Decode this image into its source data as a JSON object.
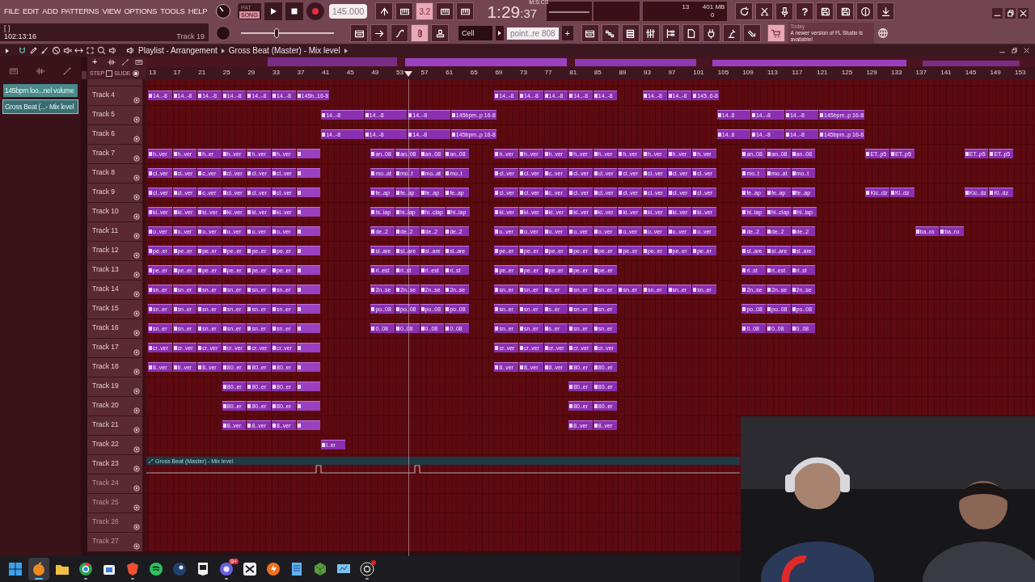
{
  "menu": [
    "FILE",
    "EDIT",
    "ADD",
    "PATTERNS",
    "VIEW",
    "OPTIONS",
    "TOOLS",
    "HELP"
  ],
  "hint": {
    "text": "[ ]",
    "time": "102:13:16",
    "track": "Track 19"
  },
  "mode": [
    {
      "label": "PAT",
      "selected": false
    },
    {
      "label": "SONG",
      "selected": true
    }
  ],
  "tempo": "145.000",
  "time": {
    "label": "M:S:CS",
    "value": "1:29",
    "centiseconds": ":37"
  },
  "monitor": {
    "voices": "13",
    "memory": "401 MB",
    "cpu": "0"
  },
  "transport_buttons": [
    {
      "selected": false
    },
    {
      "selected": false
    },
    {
      "selected": true,
      "text": "3.2"
    },
    {
      "selected": false
    },
    {
      "selected": false
    }
  ],
  "help": "?",
  "pitch": {
    "level": 0.38
  },
  "tool_buttons": [
    {
      "selected": false
    },
    {
      "selected": false
    },
    {
      "selected": false
    },
    {
      "selected": true
    },
    {
      "selected": false
    }
  ],
  "snap": "Cell",
  "pattern": "point..re 808",
  "add": "+",
  "news": {
    "date": "Today",
    "text": "A newer version of FL Studio is available!"
  },
  "playlist": {
    "breadcrumb": [
      "Playlist - Arrangement",
      "Gross Beat (Master) - Mix level"
    ],
    "browser": [
      {
        "label": "145bpm loo...nel volume",
        "selected": false
      },
      {
        "label": "Gross Beat (...- Mix level",
        "selected": true
      }
    ],
    "add": "+",
    "step": {
      "label": "STEP",
      "checked": false
    },
    "slide": {
      "label": "SLIDE",
      "on": true
    },
    "ruler": [
      "13",
      "17",
      "21",
      "25",
      "29",
      "33",
      "37",
      "41",
      "45",
      "49",
      "53",
      "57",
      "61",
      "65",
      "69",
      "73",
      "77",
      "81",
      "85",
      "89",
      "93",
      "97",
      "101",
      "105",
      "109",
      "113",
      "117",
      "121",
      "125",
      "129",
      "133",
      "137",
      "141",
      "145",
      "149",
      "153"
    ],
    "playhead": {
      "level": 0.295
    },
    "tracks": [
      {
        "name": "Track 4",
        "empty": false,
        "kind": "clips",
        "runs": [
          [
            "14..-8",
            "14..-8",
            "14..-8",
            "14..-8",
            "14..-8",
            "14..-8",
            "145b..16-8"
          ],
          [
            "14..-8",
            "14..-8",
            "14..-8",
            "14..-8",
            "14..-8"
          ],
          [
            "14..-8",
            "14..-8",
            "145..6-8"
          ]
        ]
      },
      {
        "name": "Track 5",
        "empty": false,
        "kind": "clips",
        "runs": [
          [
            "14..-8",
            "14..-8",
            "14..-8",
            "145bpm..p 16-8"
          ],
          [
            "14..8",
            "14..-8",
            "14..-8",
            "145bpm..p 16-8"
          ]
        ]
      },
      {
        "name": "Track 6",
        "empty": false,
        "kind": "clips",
        "runs": [
          [
            "14..-8",
            "14..-8",
            "14..-8",
            "145bpm..p 16-8"
          ],
          [
            "14..8",
            "14..-8",
            "14..-8",
            "145bpm..p 16-8"
          ]
        ]
      },
      {
        "name": "Track 7",
        "empty": false,
        "kind": "clips",
        "runs": [
          [
            "h..ver",
            "h..ver",
            "h..er",
            "h..ver",
            "h..ver",
            "h..ver"
          ],
          [
            "an..08",
            "an..08",
            "an..08",
            "an..08"
          ],
          [
            "h..ver",
            "h..ver",
            "h..ver",
            "h..ver",
            "h..ver",
            "h..ver",
            "h..ver",
            "h..ver",
            "h..ver"
          ],
          [
            "an..08",
            "an..08",
            "an..08"
          ],
          [
            "ET..p5",
            "ET..p5"
          ],
          [
            "ET..p5",
            "ET..p5"
          ]
        ]
      },
      {
        "name": "Track 8",
        "empty": false,
        "kind": "clips",
        "runs": [
          [
            "cl..ver",
            "cl..ver",
            "c..ver",
            "cl..ver",
            "cl..ver",
            "cl..ver"
          ],
          [
            "mo..at",
            "mo..t",
            "mo..at",
            "mo..t"
          ],
          [
            "cl..ver",
            "cl..ver",
            "c..ver",
            "cl..ver",
            "cl..ver",
            "cl..ver",
            "cl..ver",
            "cl..ver",
            "cl..ver"
          ],
          [
            "mo..t",
            "mo..at",
            "mo..t"
          ]
        ]
      },
      {
        "name": "Track 9",
        "empty": false,
        "kind": "clips",
        "runs": [
          [
            "cl..ver",
            "cl..ver",
            "c..ver",
            "cl..ver",
            "cl..ver",
            "cl..ver"
          ],
          [
            "fe..ap",
            "fe..ap",
            "fe..ap",
            "fe..ap"
          ],
          [
            "cl..ver",
            "cl..ver",
            "c..ver",
            "cl..ver",
            "cl..ver",
            "cl..ver",
            "cl..ver",
            "cl..ver",
            "cl..ver"
          ],
          [
            "fe..ap",
            "fe..ap",
            "fe..ap"
          ],
          [
            "Kic..dz",
            "Kl..dz"
          ],
          [
            "Kic..dz",
            "Kl..dz"
          ]
        ]
      },
      {
        "name": "Track 10",
        "empty": false,
        "kind": "clips",
        "runs": [
          [
            "ki..ver",
            "ki..ver",
            "ki..ver",
            "ki..ver",
            "ki..ver",
            "ki..ver"
          ],
          [
            "hi..lap",
            "hi..lap",
            "hi..clap",
            "hi..lap"
          ],
          [
            "ki..ver",
            "ki..ver",
            "ki..ver",
            "ki..ver",
            "ki..ver",
            "ki..ver",
            "ki..ver",
            "ki..ver",
            "ki..ver"
          ],
          [
            "hi..lap",
            "hi..clap",
            "hi..lap"
          ]
        ]
      },
      {
        "name": "Track 11",
        "empty": false,
        "kind": "clips",
        "runs": [
          [
            "o..ver",
            "o..ver",
            "o..ver",
            "o..ver",
            "o..ver",
            "o..ver"
          ],
          [
            "de..2",
            "de..2",
            "de..2",
            "de..2"
          ],
          [
            "o..ver",
            "o..ver",
            "o..ver",
            "o..ver",
            "o..ver",
            "o..ver",
            "o..ver",
            "o..ver",
            "o..ver"
          ],
          [
            "de..2",
            "de..2",
            "de..2"
          ],
          [
            "ba..ro",
            "ba..ro"
          ]
        ]
      },
      {
        "name": "Track 12",
        "empty": false,
        "kind": "clips",
        "runs": [
          [
            "pe..er",
            "pe..er",
            "pe..er",
            "pe..er",
            "pe..er",
            "pe..er"
          ],
          [
            "sl..are",
            "sl..are",
            "sl..are",
            "sl..are"
          ],
          [
            "pe..er",
            "pe..er",
            "pe..er",
            "pe..er",
            "pe..er",
            "pe..er",
            "pe..er",
            "pe..er",
            "pe..er"
          ],
          [
            "sl..are",
            "sl..are",
            "sl..are"
          ]
        ]
      },
      {
        "name": "Track 13",
        "empty": false,
        "kind": "clips",
        "runs": [
          [
            "pe..er",
            "pe..er",
            "pe..er",
            "pe..er",
            "pe..er",
            "pe..er"
          ],
          [
            "rl..est",
            "rl..st",
            "rl..est",
            "rl..st"
          ],
          [
            "pe..er",
            "pe..er",
            "pe..er",
            "pe..er",
            "pe..er"
          ],
          [
            "rl..st",
            "rl..est",
            "rl..st"
          ]
        ]
      },
      {
        "name": "Track 14",
        "empty": false,
        "kind": "clips",
        "runs": [
          [
            "sn..er",
            "sn..er",
            "sn..er",
            "sn..er",
            "sn..er",
            "sn..er"
          ],
          [
            "2n..se",
            "2n..se",
            "2n..se",
            "2n..se"
          ],
          [
            "sn..er",
            "sn..er",
            "s..er",
            "sn..er",
            "sn..er",
            "sn..er",
            "sn..er",
            "sn..er",
            "sn..er"
          ],
          [
            "2n..se",
            "2n..se",
            "2n..se"
          ]
        ]
      },
      {
        "name": "Track 15",
        "empty": false,
        "kind": "clips",
        "runs": [
          [
            "sn..er",
            "sn..er",
            "sn..er",
            "sn..er",
            "sn..er",
            "sn..er"
          ],
          [
            "po..08",
            "po..08",
            "po..08",
            "po..08"
          ],
          [
            "sn..er",
            "sn..er",
            "s..er",
            "sn..er",
            "sn..er"
          ],
          [
            "po..08",
            "po..08",
            "po..08"
          ]
        ]
      },
      {
        "name": "Track 16",
        "empty": false,
        "kind": "clips",
        "runs": [
          [
            "sn..er",
            "sn..er",
            "sn..er",
            "sn..er",
            "sn..er",
            "sn..er"
          ],
          [
            "0..08",
            "0..08",
            "0..08",
            "0..08"
          ],
          [
            "sn..er",
            "sn..er",
            "s..er",
            "sn..er",
            "sn..er"
          ],
          [
            "0..08",
            "0..08",
            "0..08"
          ]
        ]
      },
      {
        "name": "Track 17",
        "empty": false,
        "kind": "clips",
        "runs": [
          [
            "cr..ver",
            "cr..ver",
            "cr..ver",
            "cr..ver",
            "cr..ver",
            "cr..ver"
          ],
          [
            "cr..ver",
            "cr..ver",
            "cr..ver",
            "cr..ver",
            "cr..ver"
          ]
        ]
      },
      {
        "name": "Track 18",
        "empty": false,
        "kind": "clips",
        "runs": [
          [
            "8..ver",
            "8..ver",
            "8..ver",
            "80..er",
            "80..er",
            "80..er"
          ],
          [
            "8..ver",
            "8..ver",
            "8..ver",
            "80..er",
            "80..er"
          ]
        ]
      },
      {
        "name": "Track 19",
        "empty": false,
        "kind": "clips",
        "runs": [
          [
            "80..er",
            "80..er",
            "80..er"
          ],
          [
            "80..er",
            "80..er"
          ]
        ]
      },
      {
        "name": "Track 20",
        "empty": false,
        "kind": "clips",
        "runs": [
          [
            "80..er",
            "80..er",
            "80..er"
          ],
          [
            "80..er",
            "80..er"
          ]
        ]
      },
      {
        "name": "Track 21",
        "empty": false,
        "kind": "clips",
        "runs": [
          [
            "8..ver",
            "8..ver",
            "8..ver"
          ],
          [
            "8..ver",
            "8..ver"
          ]
        ]
      },
      {
        "name": "Track 22",
        "empty": false,
        "kind": "clips",
        "runs": [
          [
            "l..er"
          ]
        ]
      },
      {
        "name": "Track 23",
        "empty": false,
        "kind": "automation",
        "runs": [
          [
            "Gross Beat (Master) - Mix level"
          ]
        ]
      },
      {
        "name": "Track 24",
        "empty": true
      },
      {
        "name": "Track 25",
        "empty": true
      },
      {
        "name": "Track 26",
        "empty": true
      },
      {
        "name": "Track 27",
        "empty": true
      }
    ]
  },
  "webcam": {
    "kind": "picture"
  },
  "taskbar": [
    {
      "selected": false,
      "running": false
    },
    {
      "selected": true,
      "running": true
    },
    {
      "selected": false,
      "running": false
    },
    {
      "selected": false,
      "running": true
    },
    {
      "selected": false,
      "running": false
    },
    {
      "selected": false,
      "running": true
    },
    {
      "selected": false,
      "running": false
    },
    {
      "selected": false,
      "running": false
    },
    {
      "selected": false,
      "running": false
    },
    {
      "selected": false,
      "running": true,
      "badge": "9+"
    },
    {
      "selected": false,
      "running": false
    },
    {
      "selected": false,
      "running": false
    },
    {
      "selected": false,
      "running": false
    },
    {
      "selected": false,
      "running": false
    },
    {
      "selected": false,
      "running": false
    },
    {
      "selected": false,
      "running": true,
      "notification": true
    }
  ]
}
